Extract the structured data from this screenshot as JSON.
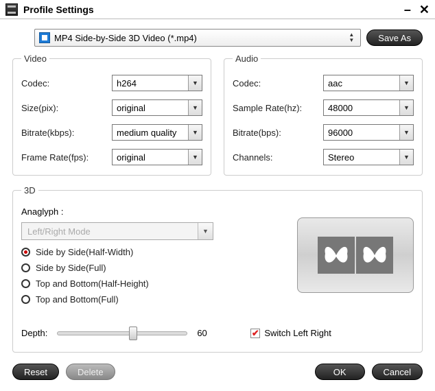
{
  "window": {
    "title": "Profile Settings"
  },
  "profile": {
    "selected": "MP4 Side-by-Side 3D Video (*.mp4)",
    "save_as_label": "Save As"
  },
  "video": {
    "legend": "Video",
    "codec_label": "Codec:",
    "codec_value": "h264",
    "size_label": "Size(pix):",
    "size_value": "original",
    "bitrate_label": "Bitrate(kbps):",
    "bitrate_value": "medium quality",
    "framerate_label": "Frame Rate(fps):",
    "framerate_value": "original"
  },
  "audio": {
    "legend": "Audio",
    "codec_label": "Codec:",
    "codec_value": "aac",
    "samplerate_label": "Sample Rate(hz):",
    "samplerate_value": "48000",
    "bitrate_label": "Bitrate(bps):",
    "bitrate_value": "96000",
    "channels_label": "Channels:",
    "channels_value": "Stereo"
  },
  "threeD": {
    "legend": "3D",
    "anaglyph_label": "Anaglyph :",
    "anaglyph_value": "Left/Right Mode",
    "modes": [
      "Side by Side(Half-Width)",
      "Side by Side(Full)",
      "Top and Bottom(Half-Height)",
      "Top and Bottom(Full)"
    ],
    "selected_mode_index": 0,
    "depth_label": "Depth:",
    "depth_value": "60",
    "switch_label": "Switch Left Right",
    "switch_checked": true
  },
  "buttons": {
    "reset": "Reset",
    "delete": "Delete",
    "ok": "OK",
    "cancel": "Cancel"
  }
}
